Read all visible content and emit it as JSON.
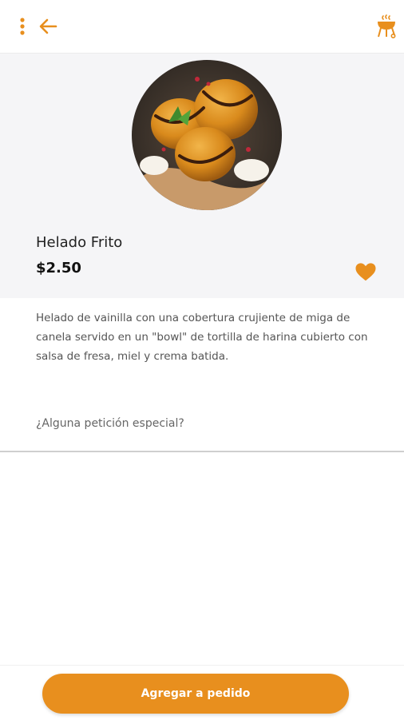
{
  "colors": {
    "accent": "#e88f1e",
    "hero_bg": "#f5f5f7"
  },
  "header": {
    "menu_icon": "more-vertical-icon",
    "back_icon": "arrow-left-icon",
    "grill_icon": "grill-icon"
  },
  "product": {
    "name": "Helado Frito",
    "price": "$2.50",
    "favorite_icon": "heart-icon",
    "description": "Helado de vainilla con una cobertura crujiente de miga de canela servido en un \"bowl\" de tortilla de harina cubierto con salsa de fresa, miel y crema batida.",
    "special_request_placeholder": "¿Alguna petición especial?"
  },
  "footer": {
    "add_label": "Agregar a pedido"
  }
}
